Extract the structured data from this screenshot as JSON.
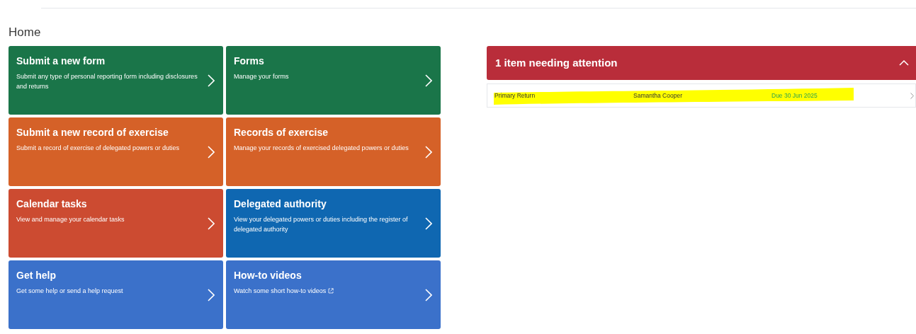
{
  "page_title": "Home",
  "tiles": [
    {
      "title": "Submit a new form",
      "description": "Submit any type of personal reporting form including disclosures and returns",
      "color": "#1a7549",
      "external": false
    },
    {
      "title": "Forms",
      "description": "Manage your forms",
      "color": "#1a7549",
      "external": false
    },
    {
      "title": "Submit a new record of exercise",
      "description": "Submit a record of exercise of delegated powers or duties",
      "color": "#d56128",
      "external": false
    },
    {
      "title": "Records of exercise",
      "description": "Manage your records of exercised delegated powers or duties",
      "color": "#d56128",
      "external": false
    },
    {
      "title": "Calendar tasks",
      "description": "View and manage your calendar tasks",
      "color": "#cc4b31",
      "external": false
    },
    {
      "title": "Delegated authority",
      "description": "View your delegated powers or duties including the register of delegated authority",
      "color": "#0f67b1",
      "external": false
    },
    {
      "title": "Get help",
      "description": "Get some help or send a help request",
      "color": "#3b71ca",
      "external": false
    },
    {
      "title": "How-to videos",
      "description": "Watch some short how-to videos",
      "color": "#3b71ca",
      "external": true
    }
  ],
  "attention_panel": {
    "title": "1 item needing attention",
    "expanded": true,
    "items": [
      {
        "name": "Primary Return",
        "person": "Samantha Cooper",
        "due": "Due 30 Jun 2025",
        "highlighted": true
      }
    ]
  }
}
